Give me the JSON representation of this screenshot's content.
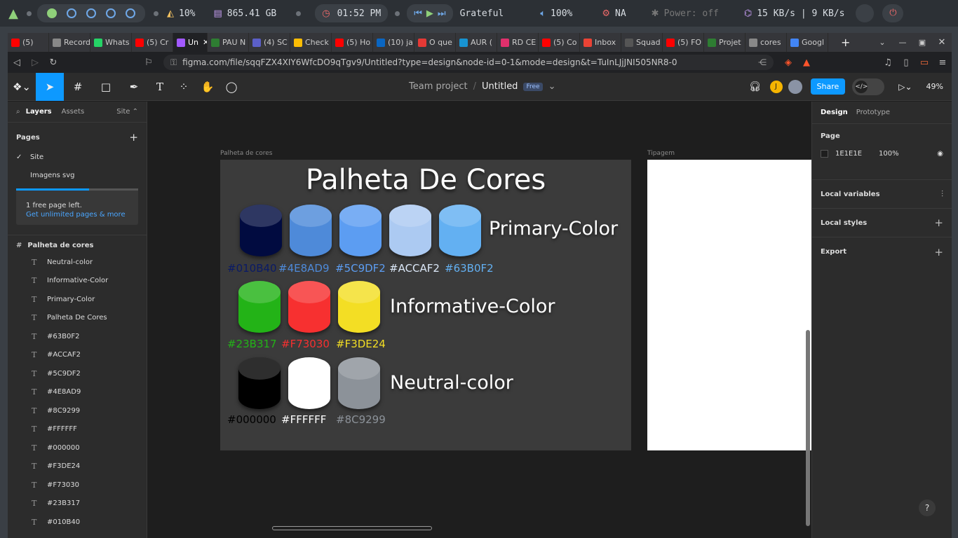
{
  "os": {
    "cpu": "10%",
    "disk": "865.41 GB",
    "time": "01:52 PM",
    "track": "Grateful",
    "volume": "100%",
    "net_label": "NA",
    "bt": "Power: off",
    "speed": "15 KB/s | 9 KB/s"
  },
  "tabs": [
    {
      "label": "(5)",
      "color": "#ff0000"
    },
    {
      "label": "Record",
      "color": "#888888"
    },
    {
      "label": "Whats",
      "color": "#25d366"
    },
    {
      "label": "(5) Cr",
      "color": "#ff0000"
    },
    {
      "label": "Un",
      "color": "#a259ff"
    },
    {
      "label": "PAU N",
      "color": "#2e7d32"
    },
    {
      "label": "(4) SC",
      "color": "#5b5fc7"
    },
    {
      "label": "Check",
      "color": "#fbbc04"
    },
    {
      "label": "(5) Ho",
      "color": "#ff0000"
    },
    {
      "label": "(10) ja",
      "color": "#0a66c2"
    },
    {
      "label": "O que",
      "color": "#e53935"
    },
    {
      "label": "AUR (",
      "color": "#1793d1"
    },
    {
      "label": "RD CE",
      "color": "#e1306c"
    },
    {
      "label": "(5) Co",
      "color": "#ff0000"
    },
    {
      "label": "Inbox",
      "color": "#ea4335"
    },
    {
      "label": "Squad",
      "color": "#555555"
    },
    {
      "label": "(5) FO",
      "color": "#ff0000"
    },
    {
      "label": "Projet",
      "color": "#2e7d32"
    },
    {
      "label": "cores",
      "color": "#888888"
    },
    {
      "label": "Googl",
      "color": "#4285f4"
    }
  ],
  "url": "figma.com/file/sqqFZX4XIY6WfcDO9qTgv9/Untitled?type=design&node-id=0-1&mode=design&t=TuInLJjJNI505NR8-0",
  "figma": {
    "team": "Team project",
    "file": "Untitled",
    "plan": "Free",
    "share": "Share",
    "zoom": "49%",
    "avatar_letter": "J"
  },
  "left": {
    "tab_layers": "Layers",
    "tab_assets": "Assets",
    "page_dropdown": "Site",
    "pages_title": "Pages",
    "pages": [
      "Site",
      "Imagens svg"
    ],
    "upsell_text": "1 free page left.",
    "upsell_link": "Get unlimited pages & more",
    "frame_name": "Palheta de cores",
    "layers": [
      "Neutral-color",
      "Informative-Color",
      "Primary-Color",
      "Palheta De Cores",
      "#63B0F2",
      "#ACCAF2",
      "#5C9DF2",
      "#4E8AD9",
      "#8C9299",
      "#FFFFFF",
      "#000000",
      "#F3DE24",
      "#F73030",
      "#23B317",
      "#010B40"
    ]
  },
  "canvas": {
    "frame1_label": "Palheta de cores",
    "frame2_label": "Tipagem",
    "title": "Palheta De Cores",
    "groups": [
      {
        "label": "Primary-Color",
        "swatches": [
          {
            "hex": "#010B40",
            "color": "#010b40",
            "text": "#0a1a66"
          },
          {
            "hex": "#4E8AD9",
            "color": "#4e8ad9",
            "text": "#4e8ad9"
          },
          {
            "hex": "#5C9DF2",
            "color": "#5c9df2",
            "text": "#5c9df2"
          },
          {
            "hex": "#ACCAF2",
            "color": "#accaf2",
            "text": "#dce8f8"
          },
          {
            "hex": "#63B0F2",
            "color": "#63b0f2",
            "text": "#63b0f2"
          }
        ]
      },
      {
        "label": "Informative-Color",
        "swatches": [
          {
            "hex": "#23B317",
            "color": "#23b317",
            "text": "#23b317"
          },
          {
            "hex": "#F73030",
            "color": "#f73030",
            "text": "#f73030"
          },
          {
            "hex": "#F3DE24",
            "color": "#f3de24",
            "text": "#f3de24"
          }
        ]
      },
      {
        "label": "Neutral-color",
        "swatches": [
          {
            "hex": "#000000",
            "color": "#000000",
            "text": "#000000"
          },
          {
            "hex": "#FFFFFF",
            "color": "#ffffff",
            "text": "#ffffff"
          },
          {
            "hex": "#8C9299",
            "color": "#8c9299",
            "text": "#8c9299"
          }
        ]
      }
    ]
  },
  "right": {
    "tab_design": "Design",
    "tab_prototype": "Prototype",
    "page_title": "Page",
    "page_color": "1E1E1E",
    "page_opacity": "100%",
    "sections": [
      "Local variables",
      "Local styles",
      "Export"
    ]
  }
}
